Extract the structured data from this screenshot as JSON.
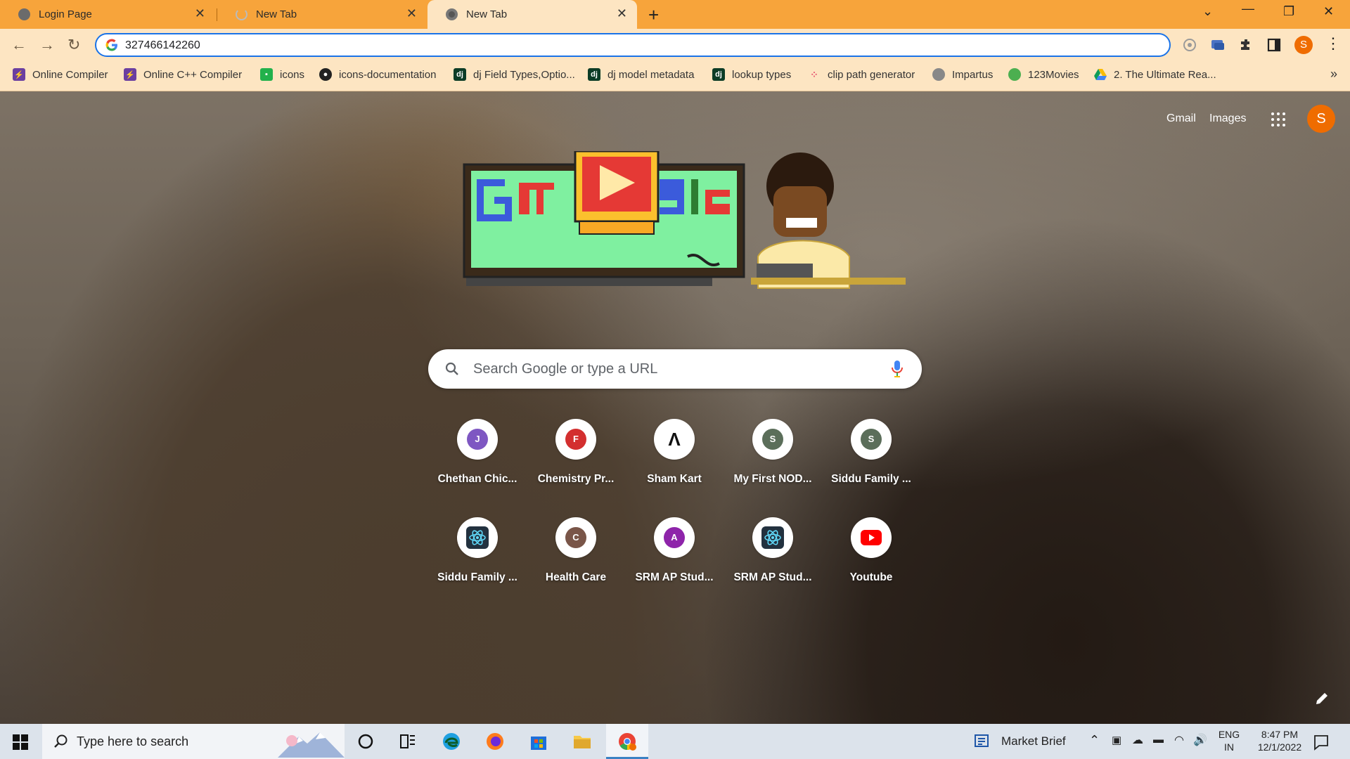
{
  "browser": {
    "tabs": [
      {
        "title": "Login Page"
      },
      {
        "title": "New Tab"
      },
      {
        "title": "New Tab"
      }
    ],
    "address": "327466142260",
    "profile_initial": "S"
  },
  "bookmarks": [
    {
      "label": "Online Compiler",
      "icon": "bolt-icon",
      "color": "#6b3fa0"
    },
    {
      "label": "Online C++ Compiler",
      "icon": "bolt-icon",
      "color": "#6b3fa0"
    },
    {
      "label": "icons",
      "icon": "icons-app-icon",
      "color": "#22b14c"
    },
    {
      "label": "icons-documentation",
      "icon": "github-icon",
      "color": "#222222"
    },
    {
      "label": "dj Field Types,Optio...",
      "icon": "django-icon",
      "color": "#0c3c26"
    },
    {
      "label": "dj model metadata",
      "icon": "django-icon",
      "color": "#0c3c26"
    },
    {
      "label": "lookup types",
      "icon": "django-icon",
      "color": "#0c3c26"
    },
    {
      "label": "clip path generator",
      "icon": "dots-icon",
      "color": "#e85d75"
    },
    {
      "label": "Impartus",
      "icon": "globe-icon",
      "color": "#666666"
    },
    {
      "label": "123Movies",
      "icon": "movies-icon",
      "color": "#4caf50"
    },
    {
      "label": "2. The Ultimate Rea...",
      "icon": "drive-icon",
      "color": "#fbbc04"
    }
  ],
  "ntp": {
    "gmail": "Gmail",
    "images": "Images",
    "avatar_initial": "S",
    "search_placeholder": "Search Google or type a URL",
    "shortcuts": [
      {
        "label": "Chethan Chic...",
        "letter": "J",
        "color": "#7e57c2"
      },
      {
        "label": "Chemistry Pr...",
        "letter": "F",
        "color": "#d32f2f"
      },
      {
        "label": "Sham Kart",
        "letter": "Λ",
        "color": "#000000"
      },
      {
        "label": "My First NOD...",
        "letter": "S",
        "color": "#5b6e5a"
      },
      {
        "label": "Siddu Family ...",
        "letter": "S",
        "color": "#5b6e5a"
      },
      {
        "label": "Siddu Family ...",
        "letter": "",
        "color": "#22313f"
      },
      {
        "label": "Health Care",
        "letter": "C",
        "color": "#795548"
      },
      {
        "label": "SRM AP Stud...",
        "letter": "A",
        "color": "#8e24aa"
      },
      {
        "label": "SRM AP Stud...",
        "letter": "",
        "color": "#22313f"
      },
      {
        "label": "Youtube",
        "letter": "",
        "color": "#ff0000"
      }
    ]
  },
  "taskbar": {
    "search_text": "Type here to search",
    "market_brief": "Market Brief",
    "lang_1": "ENG",
    "lang_2": "IN",
    "time": "8:47 PM",
    "date": "12/1/2022"
  }
}
